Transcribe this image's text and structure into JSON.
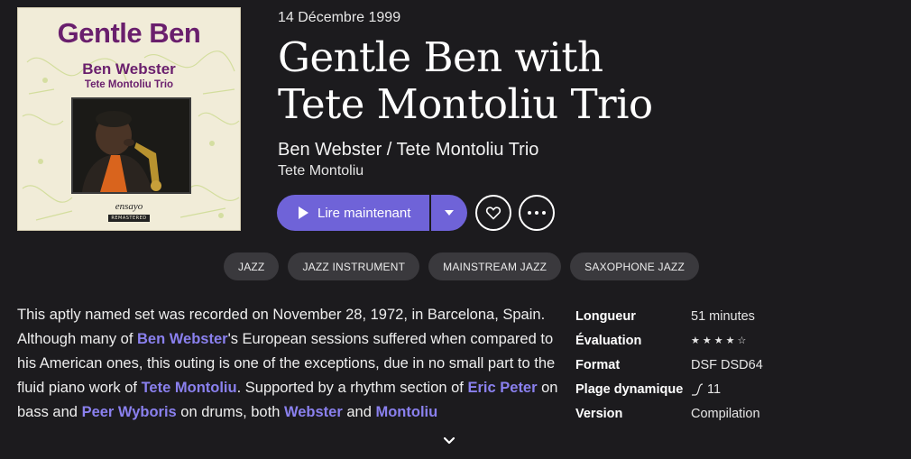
{
  "cover": {
    "title": "Gentle Ben",
    "artist": "Ben Webster",
    "subtitle": "Tete Montoliu Trio",
    "label": "ensayo",
    "label_sub": "REMASTERED"
  },
  "album": {
    "date": "14 Décembre 1999",
    "title_line1": "Gentle Ben with",
    "title_line2": "Tete Montoliu Trio",
    "artists": "Ben Webster / Tete Montoliu Trio",
    "composer": "Tete Montoliu"
  },
  "actions": {
    "play_label": "Lire maintenant",
    "play_icon": "play-icon",
    "dropdown_icon": "caret-down-icon",
    "favorite_icon": "heart-icon",
    "more_icon": "more-horizontal-icon",
    "accent_color": "#6f63d8"
  },
  "tags": [
    "JAZZ",
    "JAZZ INSTRUMENT",
    "MAINSTREAM JAZZ",
    "SAXOPHONE JAZZ"
  ],
  "description": {
    "s1": "This aptly named set was recorded on November 28, 1972, in Barcelona, Spain. Although many of ",
    "link1": "Ben Webster",
    "s2": "'s European sessions suffered when compared to his American ones, this outing is one of the exceptions, due in no small part to the fluid piano work of ",
    "link2": "Tete Montoliu",
    "s3": ". Supported by a rhythm section of ",
    "link3": "Eric Peter",
    "s4": " on bass and ",
    "link4": "Peer Wyboris",
    "s5": " on drums, both ",
    "link5": "Webster",
    "s6": " and ",
    "link6": "Montoliu",
    "link_color": "#8a80ee",
    "expand_icon": "chevron-down-icon"
  },
  "meta": {
    "length_label": "Longueur",
    "length_value": "51 minutes",
    "rating_label": "Évaluation",
    "rating_stars": "★★★★☆",
    "rating_value": 4,
    "rating_max": 5,
    "format_label": "Format",
    "format_value": "DSF DSD64",
    "dynamic_label": "Plage dynamique",
    "dynamic_value": "11",
    "dynamic_icon": "dynamic-range-icon",
    "version_label": "Version",
    "version_value": "Compilation"
  }
}
